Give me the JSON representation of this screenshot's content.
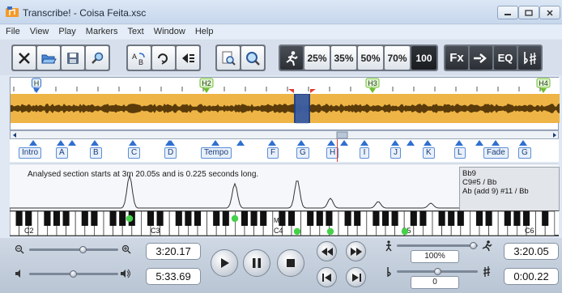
{
  "window": {
    "title": "Transcribe! - Coisa Feita.xsc"
  },
  "menu": [
    "File",
    "View",
    "Play",
    "Markers",
    "Text",
    "Window",
    "Help"
  ],
  "toolbar": {
    "speed_buttons": [
      "25%",
      "35%",
      "50%",
      "70%",
      "100"
    ],
    "fx_label": "Fx",
    "eq_label": "EQ"
  },
  "waveform": {
    "section_markers": [
      "H",
      "H2",
      "H3",
      "H4"
    ]
  },
  "markers": [
    {
      "label": "Intro"
    },
    {
      "label": "A"
    },
    {
      "label": "B"
    },
    {
      "label": "C"
    },
    {
      "label": "D"
    },
    {
      "label": "Tempo"
    },
    {
      "label": "F"
    },
    {
      "label": "G"
    },
    {
      "label": "H"
    },
    {
      "label": "I"
    },
    {
      "label": "J"
    },
    {
      "label": "K"
    },
    {
      "label": "L"
    },
    {
      "label": "Fade"
    },
    {
      "label": "G"
    }
  ],
  "analysis": {
    "message": "Analysed section starts at 3m 20.05s and is 0.225 seconds long.",
    "chords": [
      "Bb9",
      "C9#5 / Bb",
      "Ab (add 9) #11 / Bb"
    ]
  },
  "keyboard": {
    "octave_labels": [
      "C2",
      "C3",
      "C4",
      "C5",
      "C6"
    ],
    "middle_label": "Mi"
  },
  "transport": {
    "position_time": "3:20.17",
    "length_time": "5:33.69",
    "speed_percent": "100%",
    "pitch_value": "0",
    "loop_start": "3:20.05",
    "loop_length": "0:00.22"
  },
  "colors": {
    "waveform_bg": "#eeb546",
    "waveform_fg": "#5a3b09",
    "selection": "#1d3f86",
    "marker_blue": "#2f6fd0",
    "section_green": "#6dbf2c",
    "note_green": "#45d14a"
  }
}
